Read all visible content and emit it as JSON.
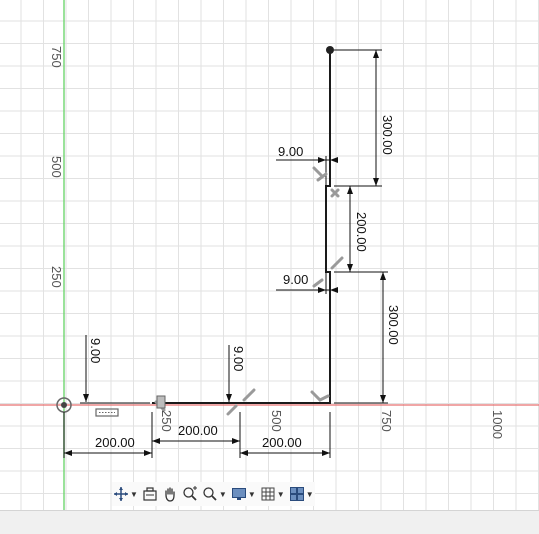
{
  "axis_labels": {
    "y": [
      "750",
      "500",
      "250"
    ],
    "x": [
      "250",
      "500",
      "750",
      "1000"
    ]
  },
  "dimensions": {
    "horizontal": [
      "200.00",
      "200.00",
      "200.00"
    ],
    "vertical_thickness": [
      "9.00",
      "9.00"
    ],
    "vertical_right": [
      "300.00",
      "200.00",
      "300.00"
    ],
    "offset_top": "9.00",
    "offset_bottom": "9.00"
  },
  "toolbar": {
    "items": [
      {
        "name": "orbit-icon",
        "has_menu": true
      },
      {
        "name": "look-at-icon",
        "has_menu": false
      },
      {
        "name": "pan-icon",
        "has_menu": false
      },
      {
        "name": "zoom-icon",
        "has_menu": false
      },
      {
        "name": "zoom-window-icon",
        "has_menu": true
      },
      {
        "name": "display-settings-icon",
        "has_menu": true
      },
      {
        "name": "grid-settings-icon",
        "has_menu": true
      },
      {
        "name": "viewports-icon",
        "has_menu": true
      }
    ]
  },
  "colors": {
    "x_axis": "#e06060",
    "y_axis": "#70d070",
    "sketch_line": "#1a1a1a",
    "constraint": "#999999"
  }
}
